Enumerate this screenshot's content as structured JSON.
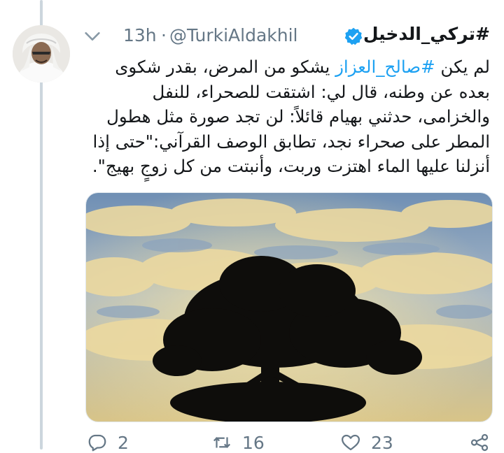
{
  "tweet": {
    "display_name": "#تركي_الدخيل",
    "handle": "@TurkiAldakhil",
    "separator": "·",
    "time": "13h",
    "text_intro": "لم يكن ",
    "hashtag": "#صالح_العزاز",
    "text_body": " يشكو من المرض، بقدر شكوى بعده عن وطنه، قال لي: اشتقت للصحراء، للنفل والخزامى، حدثني بهيام قائلاً: لن تجد صورة مثل هطول المطر على صحراء نجد، تطابق الوصف القرآني:\"حتى إذا أنزلنا عليها الماء اهتزت وربت، وأنبتت من كل زوجٍ بهيج\".",
    "media_alt": "tree-silhouette-against-cloudy-sky",
    "colors": {
      "accent": "#1da1f2",
      "muted": "#657786",
      "text": "#14171a",
      "line": "#ccd6dd"
    }
  },
  "actions": {
    "reply_count": "2",
    "retweet_count": "16",
    "like_count": "23",
    "icons": [
      "reply-icon",
      "retweet-icon",
      "like-icon",
      "share-icon"
    ]
  }
}
